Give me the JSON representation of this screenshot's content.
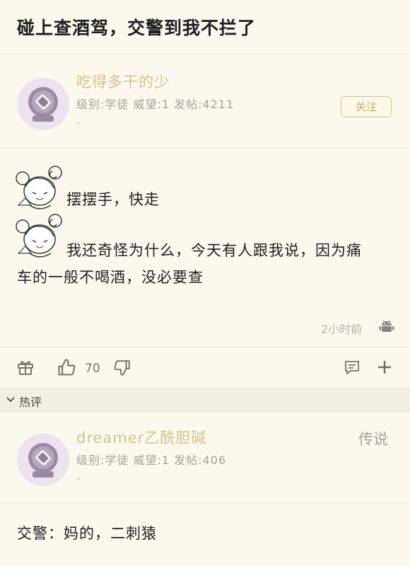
{
  "title": "碰上查酒驾，交警到我不拦了",
  "post": {
    "author": {
      "name": "吃得多干的少",
      "meta": "级别:学徒 威望:1 发帖:4211",
      "dash": "-"
    },
    "follow_label": "关注",
    "lines": [
      "摆摆手，快走",
      "我还奇怪为什么，今天有人跟我说，因为痛",
      "车的一般不喝酒，没必要查"
    ],
    "time": "2小时前",
    "likes": "70"
  },
  "hot_section": {
    "label": "热评"
  },
  "comment": {
    "author": {
      "name": "dreamer乙酰胆碱",
      "meta": "级别:学徒 威望:1 发帖:406",
      "dash": "-",
      "tag": "传说"
    },
    "text": "交警：妈的，二刺猿"
  },
  "icons": {
    "gift": "gift-icon",
    "like": "thumbs-up-icon",
    "dislike": "thumbs-down-icon",
    "reply": "comment-icon",
    "more": "plus-icon",
    "device": "android-icon",
    "collapse": "chevron-down-icon"
  },
  "colors": {
    "background": "#fbf8ee",
    "username": "#d6c38a",
    "meta": "#a9a29a",
    "follow_border": "#d8c481"
  }
}
